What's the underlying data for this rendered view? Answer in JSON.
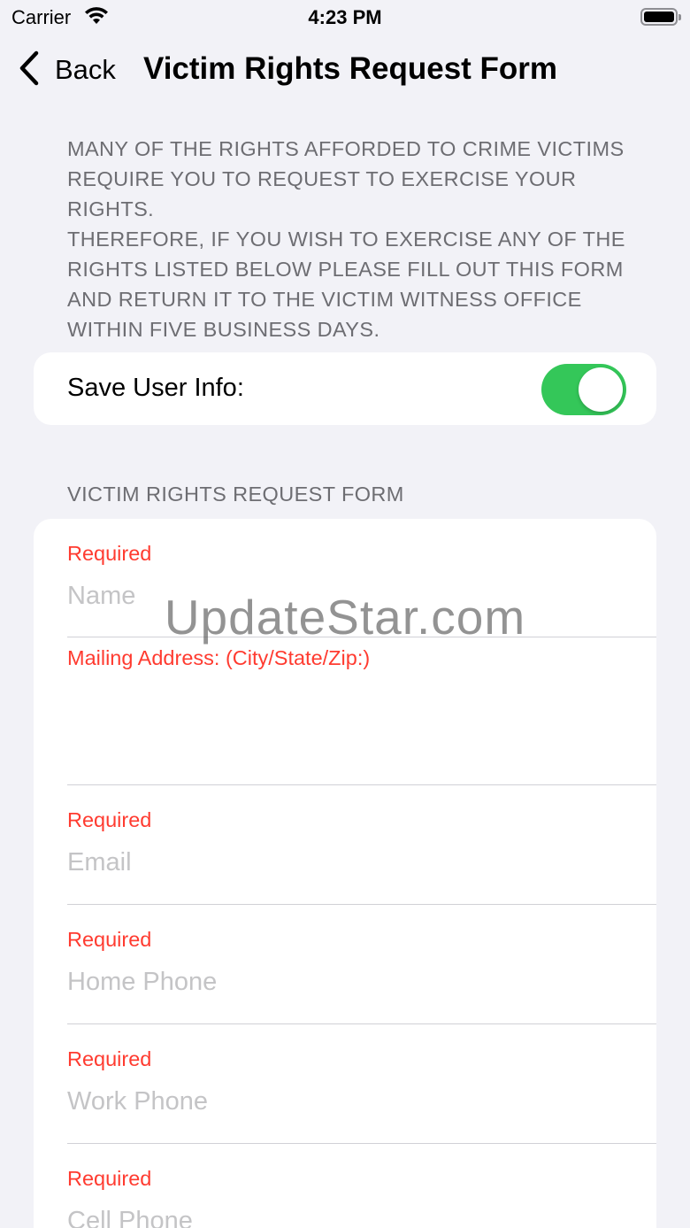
{
  "status_bar": {
    "carrier": "Carrier",
    "time": "4:23 PM"
  },
  "nav": {
    "back_label": "Back",
    "title": "Victim Rights Request Form"
  },
  "intro": {
    "paragraph1": "MANY OF THE RIGHTS AFFORDED TO CRIME VICTIMS REQUIRE YOU TO REQUEST TO EXERCISE YOUR RIGHTS.",
    "paragraph2": "THEREFORE, IF YOU WISH TO EXERCISE ANY OF THE RIGHTS LISTED BELOW PLEASE FILL OUT THIS FORM AND RETURN IT TO THE VICTIM WITNESS OFFICE WITHIN FIVE BUSINESS DAYS."
  },
  "save_user_info": {
    "label": "Save User Info:",
    "enabled": true,
    "accent": "#34c759"
  },
  "form": {
    "section_header": "VICTIM RIGHTS REQUEST FORM",
    "required_color": "#ff3b30",
    "fields": [
      {
        "label": "Required",
        "placeholder": "Name",
        "value": ""
      },
      {
        "label": "Mailing Address: (City/State/Zip:)",
        "placeholder": "",
        "value": ""
      },
      {
        "label": "Required",
        "placeholder": "Email",
        "value": ""
      },
      {
        "label": "Required",
        "placeholder": "Home Phone",
        "value": ""
      },
      {
        "label": "Required",
        "placeholder": "Work Phone",
        "value": ""
      },
      {
        "label": "Required",
        "placeholder": "Cell Phone",
        "value": ""
      }
    ]
  },
  "watermark": "UpdateStar.com"
}
